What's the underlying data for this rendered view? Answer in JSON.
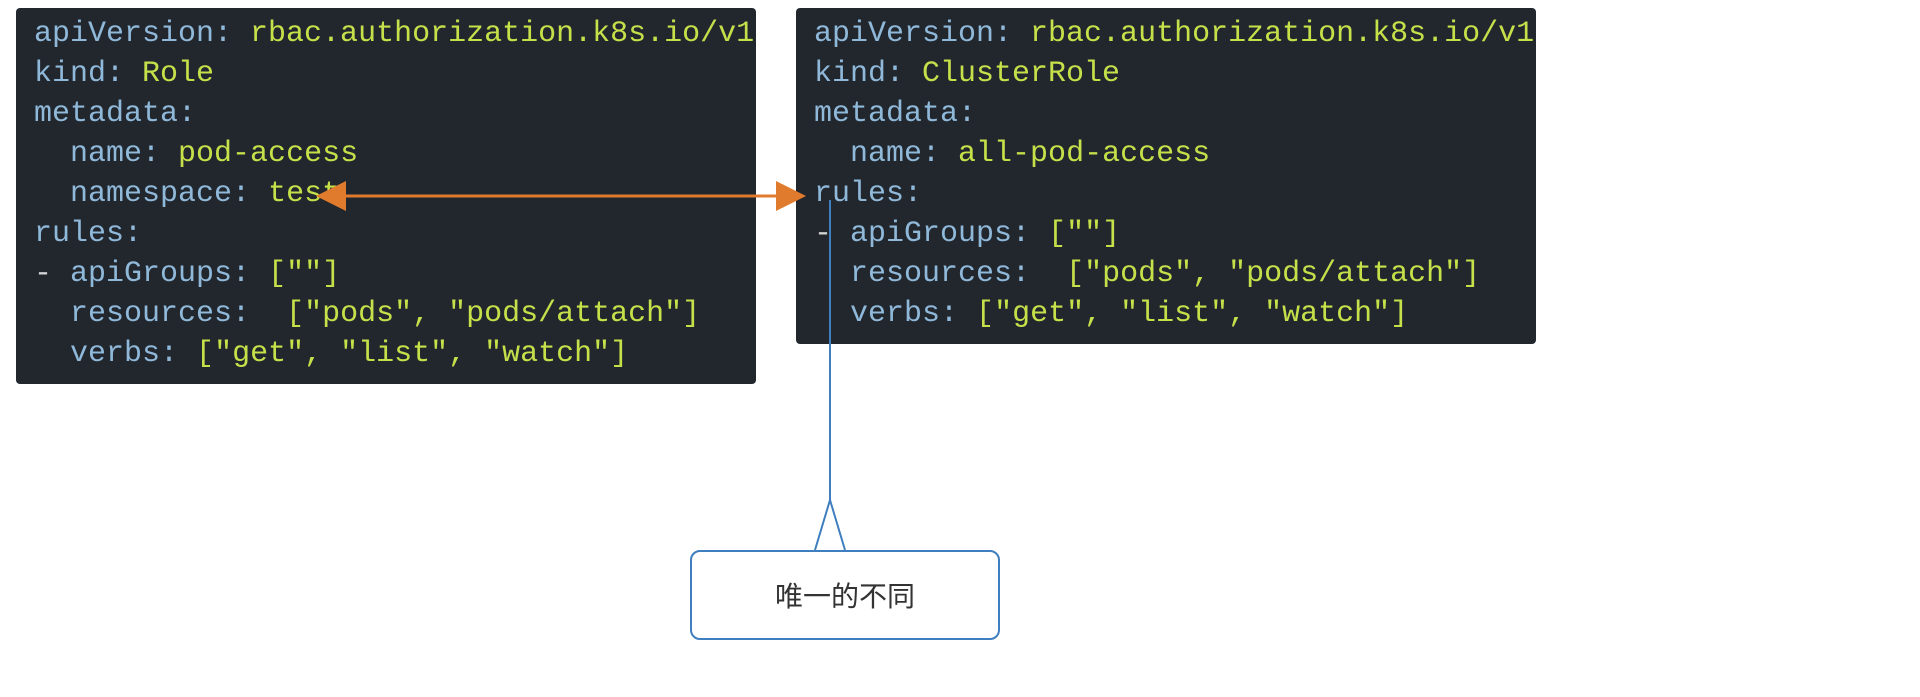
{
  "left": {
    "lines": [
      [
        [
          "key",
          "apiVersion"
        ],
        [
          "colon",
          ": "
        ],
        [
          "val",
          "rbac.authorization.k8s.io/v1"
        ]
      ],
      [
        [
          "key",
          "kind"
        ],
        [
          "colon",
          ": "
        ],
        [
          "val",
          "Role"
        ]
      ],
      [
        [
          "key",
          "metadata"
        ],
        [
          "colon",
          ":"
        ]
      ],
      [
        [
          "indent",
          "  "
        ],
        [
          "key",
          "name"
        ],
        [
          "colon",
          ": "
        ],
        [
          "val",
          "pod-access"
        ]
      ],
      [
        [
          "indent",
          "  "
        ],
        [
          "key",
          "namespace"
        ],
        [
          "colon",
          ": "
        ],
        [
          "val",
          "test"
        ]
      ],
      [
        [
          "key",
          "rules"
        ],
        [
          "colon",
          ":"
        ]
      ],
      [
        [
          "dash",
          "- "
        ],
        [
          "key",
          "apiGroups"
        ],
        [
          "colon",
          ": "
        ],
        [
          "punct",
          "["
        ],
        [
          "str",
          "\"\""
        ],
        [
          "punct",
          "]"
        ]
      ],
      [
        [
          "indent",
          "  "
        ],
        [
          "key",
          "resources"
        ],
        [
          "colon",
          ":  "
        ],
        [
          "punct",
          "["
        ],
        [
          "str",
          "\"pods\""
        ],
        [
          "punct",
          ", "
        ],
        [
          "str",
          "\"pods/attach\""
        ],
        [
          "punct",
          "]"
        ]
      ],
      [
        [
          "indent",
          "  "
        ],
        [
          "key",
          "verbs"
        ],
        [
          "colon",
          ": "
        ],
        [
          "punct",
          "["
        ],
        [
          "str",
          "\"get\""
        ],
        [
          "punct",
          ", "
        ],
        [
          "str",
          "\"list\""
        ],
        [
          "punct",
          ", "
        ],
        [
          "str",
          "\"watch\""
        ],
        [
          "punct",
          "]"
        ]
      ]
    ]
  },
  "right": {
    "lines": [
      [
        [
          "key",
          "apiVersion"
        ],
        [
          "colon",
          ": "
        ],
        [
          "val",
          "rbac.authorization.k8s.io/v1"
        ]
      ],
      [
        [
          "key",
          "kind"
        ],
        [
          "colon",
          ": "
        ],
        [
          "val",
          "ClusterRole"
        ]
      ],
      [
        [
          "key",
          "metadata"
        ],
        [
          "colon",
          ":"
        ]
      ],
      [
        [
          "indent",
          "  "
        ],
        [
          "key",
          "name"
        ],
        [
          "colon",
          ": "
        ],
        [
          "val",
          "all-pod-access"
        ]
      ],
      [
        [
          "key",
          "rules"
        ],
        [
          "colon",
          ":"
        ]
      ],
      [
        [
          "dash",
          "- "
        ],
        [
          "key",
          "apiGroups"
        ],
        [
          "colon",
          ": "
        ],
        [
          "punct",
          "["
        ],
        [
          "str",
          "\"\""
        ],
        [
          "punct",
          "]"
        ]
      ],
      [
        [
          "indent",
          "  "
        ],
        [
          "key",
          "resources"
        ],
        [
          "colon",
          ":  "
        ],
        [
          "punct",
          "["
        ],
        [
          "str",
          "\"pods\""
        ],
        [
          "punct",
          ", "
        ],
        [
          "str",
          "\"pods/attach\""
        ],
        [
          "punct",
          "]"
        ]
      ],
      [
        [
          "indent",
          "  "
        ],
        [
          "key",
          "verbs"
        ],
        [
          "colon",
          ": "
        ],
        [
          "punct",
          "["
        ],
        [
          "str",
          "\"get\""
        ],
        [
          "punct",
          ", "
        ],
        [
          "str",
          "\"list\""
        ],
        [
          "punct",
          ", "
        ],
        [
          "str",
          "\"watch\""
        ],
        [
          "punct",
          "]"
        ]
      ]
    ]
  },
  "callout": {
    "text": "唯一的不同"
  },
  "arrow": {
    "color": "#e07b2e"
  },
  "leader": {
    "color": "#3f7fbf"
  }
}
